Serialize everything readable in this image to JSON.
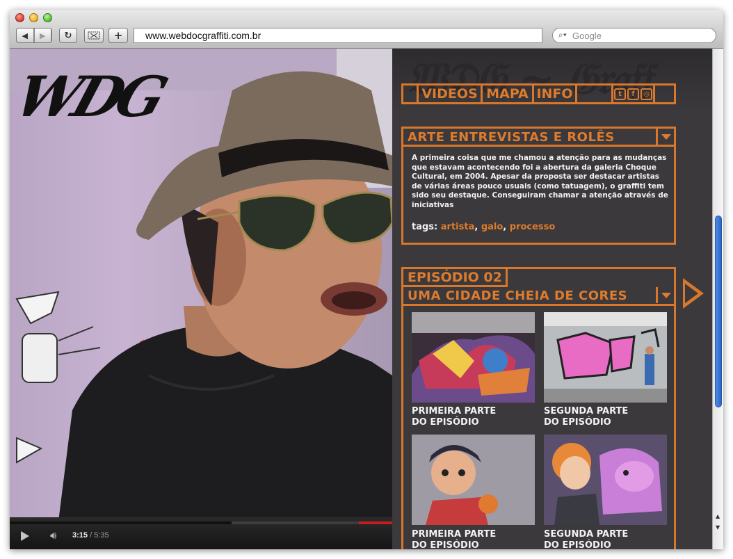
{
  "browser": {
    "url": "www.webdocgraffiti.com.br",
    "search_placeholder": "Google",
    "back_icon": "◀",
    "forward_icon": "▶",
    "reload_icon": "↻",
    "add_icon": "+"
  },
  "video": {
    "logo": "WDG",
    "time_current": "3:15",
    "time_total": "5:35",
    "progress": 0.58
  },
  "panel": {
    "nav": {
      "videos": "VIDEOS",
      "mapa": "MAPA",
      "info": "INFO",
      "twitter": "t",
      "facebook": "f",
      "other": "◎"
    },
    "article": {
      "title": "ARTE ENTREVISTAS E ROLÊS",
      "body": "A primeira coisa que me chamou a atenção para as mudanças que estavam acontecendo foi a abertura da galeria Choque Cultural, em 2004. Apesar da proposta ser destacar artistas de várias áreas pouco usuais (como tatuagem), o graffiti tem sido seu destaque. Conseguiram chamar a atenção através de iniciativas",
      "tags_label": "tags:",
      "tags": [
        "artista",
        "galo",
        "processo"
      ]
    },
    "episode": {
      "number": "EPISÓDIO 02",
      "title": "UMA CIDADE CHEIA DE CORES",
      "thumbs": [
        {
          "line1": "PRIMEIRA PARTE",
          "line2": "DO EPISÓDIO"
        },
        {
          "line1": "SEGUNDA PARTE",
          "line2": "DO EPISÓDIO"
        },
        {
          "line1": "PRIMEIRA PARTE",
          "line2": "DO EPISÓDIO"
        },
        {
          "line1": "SEGUNDA PARTE",
          "line2": "DO EPISÓDIO"
        }
      ]
    }
  },
  "colors": {
    "accent": "#de7b2c",
    "panel_bg": "#3b393c",
    "text": "#f2f2f2"
  }
}
